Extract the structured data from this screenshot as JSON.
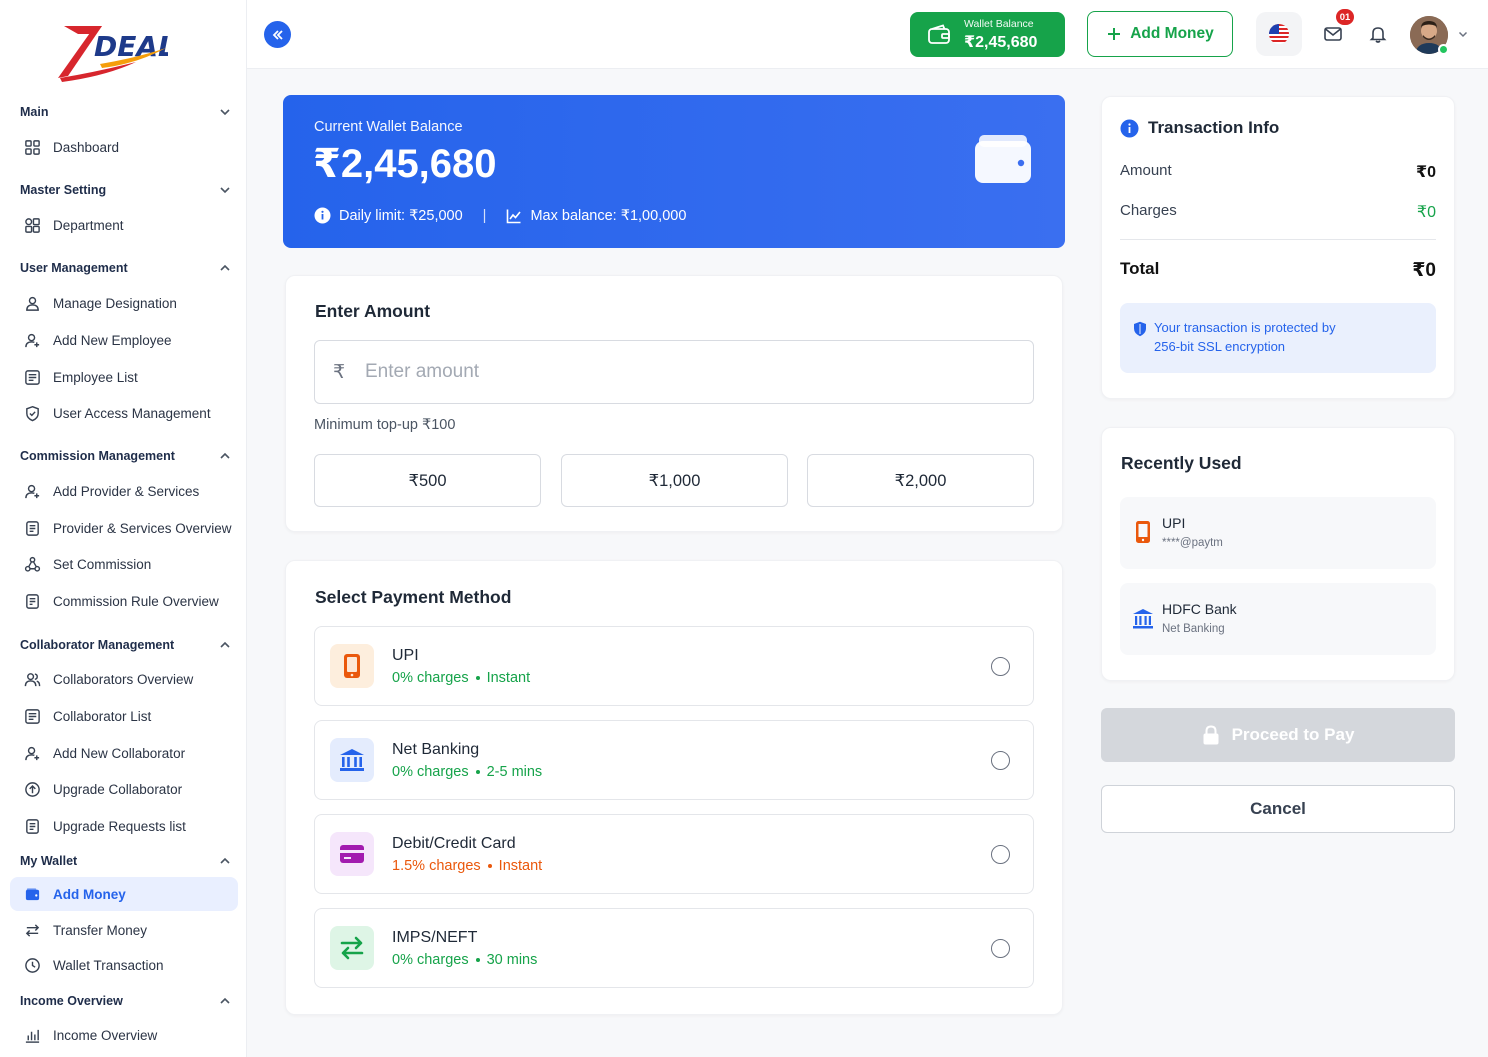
{
  "brand": {
    "logo_text": "DEAL"
  },
  "sidebar": {
    "sections": [
      {
        "title": "Main",
        "items": [
          "Dashboard"
        ]
      },
      {
        "title": "Master Setting",
        "items": [
          "Department"
        ]
      },
      {
        "title": "User Management",
        "items": [
          "Manage Designation",
          "Add New Employee",
          "Employee List",
          "User Access Management"
        ]
      },
      {
        "title": "Commission Management",
        "items": [
          "Add Provider & Services",
          "Provider & Services Overview",
          "Set Commission",
          "Commission Rule Overview"
        ]
      },
      {
        "title": "Collaborator Management",
        "items": [
          "Collaborators Overview",
          "Collaborator List",
          "Add New Collaborator",
          "Upgrade Collaborator",
          "Upgrade Requests list"
        ]
      },
      {
        "title": "My Wallet",
        "items": [
          "Add Money",
          "Transfer Money",
          "Wallet Transaction"
        ]
      },
      {
        "title": "Income Overview",
        "items": [
          "Income Overview"
        ]
      }
    ],
    "active_item": "Add Money"
  },
  "topbar": {
    "wallet_label": "Wallet Balance",
    "wallet_value": "₹2,45,680",
    "add_money_label": "Add Money",
    "mail_badge": "01"
  },
  "balance_card": {
    "label": "Current Wallet Balance",
    "value": "₹2,45,680",
    "daily_limit": "Daily limit: ₹25,000",
    "max_balance": "Max balance: ₹1,00,000"
  },
  "amount_section": {
    "title": "Enter Amount",
    "currency_symbol": "₹",
    "placeholder": "Enter amount",
    "min_note": "Minimum top-up ₹100",
    "quick_amounts": [
      "₹500",
      "₹1,000",
      "₹2,000"
    ]
  },
  "payment_section": {
    "title": "Select Payment Method",
    "methods": [
      {
        "name": "UPI",
        "charges": "0% charges",
        "speed": "Instant"
      },
      {
        "name": "Net Banking",
        "charges": "0% charges",
        "speed": "2-5 mins"
      },
      {
        "name": "Debit/Credit Card",
        "charges": "1.5% charges",
        "speed": "Instant"
      },
      {
        "name": "IMPS/NEFT",
        "charges": "0% charges",
        "speed": "30 mins"
      }
    ]
  },
  "transaction_info": {
    "title": "Transaction Info",
    "amount_label": "Amount",
    "amount_value": "₹0",
    "charges_label": "Charges",
    "charges_value": "₹0",
    "total_label": "Total",
    "total_value": "₹0",
    "ssl_line1": "Your transaction is protected by",
    "ssl_line2": "256-bit SSL encryption"
  },
  "recently_used": {
    "title": "Recently Used",
    "items": [
      {
        "name": "UPI",
        "sub": "****@paytm"
      },
      {
        "name": "HDFC Bank",
        "sub": "Net Banking"
      }
    ]
  },
  "actions": {
    "proceed_label": "Proceed to Pay",
    "cancel_label": "Cancel"
  },
  "colors": {
    "primary": "#2563eb",
    "success": "#16a34a",
    "warning": "#ea580c"
  }
}
